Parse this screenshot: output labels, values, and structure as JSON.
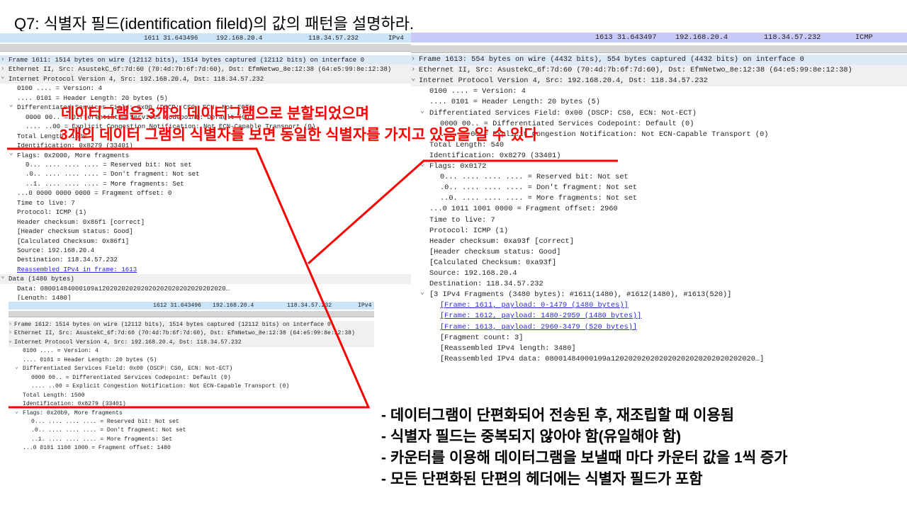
{
  "title": "Q7: 식별자 필드(identification fileld)의 값의 패턴을 설명하라.",
  "colors": {
    "annotation": "#ff0000",
    "link": "#2a2ad0",
    "packet_row_ipv4": "#cce4f7",
    "packet_row_icmp": "#c9c9f7"
  },
  "panels": [
    {
      "packet": {
        "no_time": "1611 31.643496",
        "src": "192.168.20.4",
        "dst": "118.34.57.232",
        "proto": "IPv4"
      },
      "lines": [
        {
          "t": "Frame 1611: 1514 bytes on wire (12112 bits), 1514 bytes captured (12112 bits) on interface 0",
          "lvl": 0,
          "arrow": "collapsed",
          "hl": "blue"
        },
        {
          "t": "Ethernet II, Src: AsustekC_6f:7d:60 (70:4d:7b:6f:7d:60), Dst: EfmNetwo_8e:12:38 (64:e5:99:8e:12:38)",
          "lvl": 0,
          "arrow": "collapsed",
          "hl": "grey"
        },
        {
          "t": "Internet Protocol Version 4, Src: 192.168.20.4, Dst: 118.34.57.232",
          "lvl": 0,
          "arrow": "expanded",
          "hl": "grey"
        },
        {
          "t": "0100 .... = Version: 4",
          "lvl": 1
        },
        {
          "t": ".... 0101 = Header Length: 20 bytes (5)",
          "lvl": 1
        },
        {
          "t": "Differentiated Services Field: 0x00 (DSCP: CS0, ECN: Not-ECT)",
          "lvl": 1,
          "arrow": "expanded"
        },
        {
          "t": "0000 00.. = Differentiated Services Codepoint: Default (0)",
          "lvl": 2
        },
        {
          "t": ".... ..00 = Explicit Congestion Notification: Not ECN-Capable Transport (0)",
          "lvl": 2
        },
        {
          "t": "Total Length: 1500",
          "lvl": 1
        },
        {
          "t": "Identification: 0x8279 (33401)",
          "lvl": 1
        },
        {
          "t": "Flags: 0x2000, More fragments",
          "lvl": 1,
          "arrow": "expanded"
        },
        {
          "t": "0... .... .... .... = Reserved bit: Not set",
          "lvl": 2
        },
        {
          "t": ".0.. .... .... .... = Don't fragment: Not set",
          "lvl": 2
        },
        {
          "t": "..1. .... .... .... = More fragments: Set",
          "lvl": 2
        },
        {
          "t": "...0 0000 0000 0000 = Fragment offset: 0",
          "lvl": 1
        },
        {
          "t": "Time to live: 7",
          "lvl": 1
        },
        {
          "t": "Protocol: ICMP (1)",
          "lvl": 1
        },
        {
          "t": "Header checksum: 0x86f1 [correct]",
          "lvl": 1
        },
        {
          "t": "[Header checksum status: Good]",
          "lvl": 1
        },
        {
          "t": "[Calculated Checksum: 0x86f1]",
          "lvl": 1
        },
        {
          "t": "Source: 192.168.20.4",
          "lvl": 1
        },
        {
          "t": "Destination: 118.34.57.232",
          "lvl": 1
        },
        {
          "t": "Reassembled IPv4 in frame: 1613",
          "lvl": 1,
          "link": true
        },
        {
          "t": "Data (1480 bytes)",
          "lvl": 0,
          "arrow": "expanded",
          "hl": "grey"
        },
        {
          "t": "Data: 08001484000109a120202020202020202020202020202020…",
          "lvl": 1
        },
        {
          "t": "[Length: 1480]",
          "lvl": 1
        }
      ]
    },
    {
      "packet": {
        "no_time": "1613 31.643497",
        "src": "192.168.20.4",
        "dst": "118.34.57.232",
        "proto": "ICMP"
      },
      "lines": [
        {
          "t": "Frame 1613: 554 bytes on wire (4432 bits), 554 bytes captured (4432 bits) on interface 0",
          "lvl": 0,
          "arrow": "collapsed",
          "hl": "blue"
        },
        {
          "t": "Ethernet II, Src: AsustekC_6f:7d:60 (70:4d:7b:6f:7d:60), Dst: EfmNetwo_8e:12:38 (64:e5:99:8e:12:38)",
          "lvl": 0,
          "arrow": "collapsed",
          "hl": "grey"
        },
        {
          "t": "Internet Protocol Version 4, Src: 192.168.20.4, Dst: 118.34.57.232",
          "lvl": 0,
          "arrow": "expanded",
          "hl": "grey"
        },
        {
          "t": "0100 .... = Version: 4",
          "lvl": 1
        },
        {
          "t": ".... 0101 = Header Length: 20 bytes (5)",
          "lvl": 1
        },
        {
          "t": "Differentiated Services Field: 0x00 (DSCP: CS0, ECN: Not-ECT)",
          "lvl": 1,
          "arrow": "expanded"
        },
        {
          "t": "0000 00.. = Differentiated Services Codepoint: Default (0)",
          "lvl": 2
        },
        {
          "t": ".... ..00 = Explicit Congestion Notification: Not ECN-Capable Transport (0)",
          "lvl": 2
        },
        {
          "t": "Total Length: 540",
          "lvl": 1
        },
        {
          "t": "Identification: 0x8279 (33401)",
          "lvl": 1
        },
        {
          "t": "Flags: 0x0172",
          "lvl": 1,
          "arrow": "expanded"
        },
        {
          "t": "0... .... .... .... = Reserved bit: Not set",
          "lvl": 2
        },
        {
          "t": ".0.. .... .... .... = Don't fragment: Not set",
          "lvl": 2
        },
        {
          "t": "..0. .... .... .... = More fragments: Not set",
          "lvl": 2
        },
        {
          "t": "...0 1011 1001 0000 = Fragment offset: 2960",
          "lvl": 1
        },
        {
          "t": "Time to live: 7",
          "lvl": 1
        },
        {
          "t": "Protocol: ICMP (1)",
          "lvl": 1
        },
        {
          "t": "Header checksum: 0xa93f [correct]",
          "lvl": 1
        },
        {
          "t": "[Header checksum status: Good]",
          "lvl": 1
        },
        {
          "t": "[Calculated Checksum: 0xa93f]",
          "lvl": 1
        },
        {
          "t": "Source: 192.168.20.4",
          "lvl": 1
        },
        {
          "t": "Destination: 118.34.57.232",
          "lvl": 1
        },
        {
          "t": "[3 IPv4 Fragments (3480 bytes): #1611(1480), #1612(1480), #1613(520)]",
          "lvl": 1,
          "arrow": "expanded"
        },
        {
          "t": "[Frame: 1611, payload: 0-1479 (1480 bytes)]",
          "lvl": 2,
          "link": true
        },
        {
          "t": "[Frame: 1612, payload: 1480-2959 (1480 bytes)]",
          "lvl": 2,
          "link": true
        },
        {
          "t": "[Frame: 1613, payload: 2960-3479 (520 bytes)]",
          "lvl": 2,
          "link": true
        },
        {
          "t": "[Fragment count: 3]",
          "lvl": 2
        },
        {
          "t": "[Reassembled IPv4 length: 3480]",
          "lvl": 2
        },
        {
          "t": "[Reassembled IPv4 data: 08001484000109a120202020202020202020202020202020…]",
          "lvl": 2
        }
      ]
    },
    {
      "packet": {
        "no_time": "1612 31.643496",
        "src": "192.168.20.4",
        "dst": "118.34.57.232",
        "proto": "IPv4"
      },
      "lines": [
        {
          "t": "Frame 1612: 1514 bytes on wire (12112 bits), 1514 bytes captured (12112 bits) on interface 0",
          "lvl": 0,
          "arrow": "collapsed",
          "hl": "grey"
        },
        {
          "t": "Ethernet II, Src: AsustekC_6f:7d:60 (70:4d:7b:6f:7d:60), Dst: EfmNetwo_8e:12:38 (64:e5:99:8e:12:38)",
          "lvl": 0,
          "arrow": "collapsed",
          "hl": "grey"
        },
        {
          "t": "Internet Protocol Version 4, Src: 192.168.20.4, Dst: 118.34.57.232",
          "lvl": 0,
          "arrow": "expanded",
          "hl": "grey"
        },
        {
          "t": "0100 .... = Version: 4",
          "lvl": 1
        },
        {
          "t": ".... 0101 = Header Length: 20 bytes (5)",
          "lvl": 1
        },
        {
          "t": "Differentiated Services Field: 0x00 (DSCP: CS0, ECN: Not-ECT)",
          "lvl": 1,
          "arrow": "expanded"
        },
        {
          "t": "0000 00.. = Differentiated Services Codepoint: Default (0)",
          "lvl": 2
        },
        {
          "t": ".... ..00 = Explicit Congestion Notification: Not ECN-Capable Transport (0)",
          "lvl": 2
        },
        {
          "t": "Total Length: 1500",
          "lvl": 1
        },
        {
          "t": "Identification: 0x8279 (33401)",
          "lvl": 1
        },
        {
          "t": "Flags: 0x20b9, More fragments",
          "lvl": 1,
          "arrow": "expanded"
        },
        {
          "t": "0... .... .... .... = Reserved bit: Not set",
          "lvl": 2
        },
        {
          "t": ".0.. .... .... .... = Don't fragment: Not set",
          "lvl": 2
        },
        {
          "t": "..1. .... .... .... = More fragments: Set",
          "lvl": 2
        },
        {
          "t": "...0 0101 1100 1000 = Fragment offset: 1480",
          "lvl": 1
        }
      ]
    }
  ],
  "annotation": {
    "line1": "데이터그램은 3개의 데이터그램으로 분할되었으며",
    "line2": "3개의 데이터 그램의 식별자를 보면 동일한 식별자를 가지고 있음을 알 수 있다"
  },
  "bullets": [
    "- 데이터그램이 단편화되어 전송된 후, 재조립할 때 이용됨",
    "- 식별자 필드는 중복되지 않아야 함(유일해야 함)",
    "- 카운터를 이용해 데이터그램을 보낼때 마다 카운터 값을 1씩 증가",
    "- 모든 단편화된 단편의 헤더에는 식별자 필드가 포함"
  ]
}
